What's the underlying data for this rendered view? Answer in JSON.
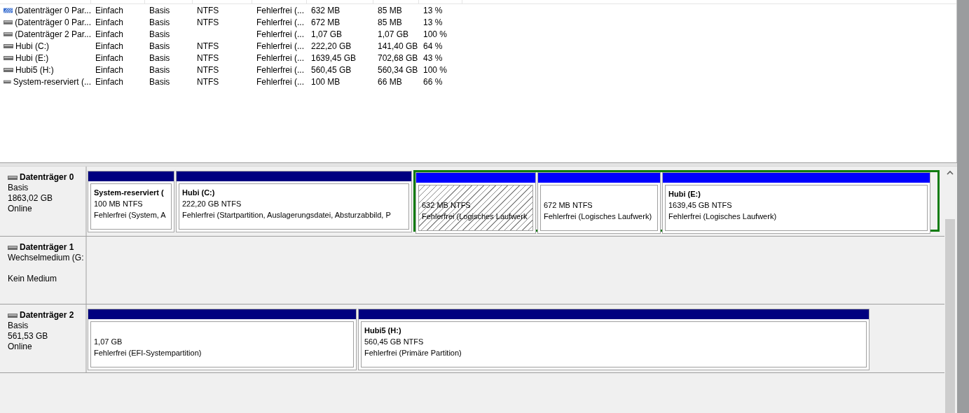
{
  "volume_list": {
    "rows": [
      {
        "selected": true,
        "cells": [
          "(Datenträger 0 Par...",
          "Einfach",
          "Basis",
          "NTFS",
          "Fehlerfrei (...",
          "632 MB",
          "85 MB",
          "13 %"
        ]
      },
      {
        "selected": false,
        "cells": [
          "(Datenträger 0 Par...",
          "Einfach",
          "Basis",
          "NTFS",
          "Fehlerfrei (...",
          "672 MB",
          "85 MB",
          "13 %"
        ]
      },
      {
        "selected": false,
        "cells": [
          "(Datenträger 2 Par...",
          "Einfach",
          "Basis",
          "",
          "Fehlerfrei (...",
          "1,07 GB",
          "1,07 GB",
          "100 %"
        ]
      },
      {
        "selected": false,
        "cells": [
          "Hubi (C:)",
          "Einfach",
          "Basis",
          "NTFS",
          "Fehlerfrei (...",
          "222,20 GB",
          "141,40 GB",
          "64 %"
        ]
      },
      {
        "selected": false,
        "cells": [
          "Hubi (E:)",
          "Einfach",
          "Basis",
          "NTFS",
          "Fehlerfrei (...",
          "1639,45 GB",
          "702,68 GB",
          "43 %"
        ]
      },
      {
        "selected": false,
        "cells": [
          "Hubi5 (H:)",
          "Einfach",
          "Basis",
          "NTFS",
          "Fehlerfrei (...",
          "560,45 GB",
          "560,34 GB",
          "100 %"
        ]
      },
      {
        "selected": false,
        "cells": [
          "System-reserviert (...",
          "Einfach",
          "Basis",
          "NTFS",
          "Fehlerfrei (...",
          "100 MB",
          "66 MB",
          "66 %"
        ]
      }
    ]
  },
  "disks": [
    {
      "title": "Datenträger 0",
      "lines": [
        "Basis",
        "1863,02 GB",
        "Online"
      ],
      "partitions": [
        {
          "kind": "primary",
          "selected": false,
          "name": "System-reserviert  (",
          "size": "100 MB NTFS",
          "status": "Fehlerfrei (System, A"
        },
        {
          "kind": "primary",
          "selected": false,
          "name": "Hubi  (C:)",
          "size": "222,20 GB NTFS",
          "status": "Fehlerfrei (Startpartition, Auslagerungsdatei, Absturzabbild, P"
        },
        {
          "kind": "extended",
          "children": [
            {
              "kind": "logical",
              "selected": true,
              "size": "632 MB NTFS",
              "status": "Fehlerfrei (Logisches Laufwerk"
            },
            {
              "kind": "logical",
              "selected": false,
              "size": "672 MB NTFS",
              "status": "Fehlerfrei (Logisches Laufwerk)"
            },
            {
              "kind": "logical",
              "selected": false,
              "name": "Hubi  (E:)",
              "size": "1639,45 GB NTFS",
              "status": "Fehlerfrei (Logisches Laufwerk)"
            }
          ]
        }
      ]
    },
    {
      "title": "Datenträger 1",
      "kind": "removable",
      "lines": [
        "Wechselmedium (G:",
        "Kein Medium"
      ]
    },
    {
      "title": "Datenträger 2",
      "lines": [
        "Basis",
        "561,53 GB",
        "Online"
      ],
      "partitions": [
        {
          "kind": "primary",
          "selected": false,
          "size": "1,07 GB",
          "status": "Fehlerfrei (EFI-Systempartition)"
        },
        {
          "kind": "primary",
          "selected": false,
          "name": "Hubi5  (H:)",
          "size": "560,45 GB NTFS",
          "status": "Fehlerfrei (Primäre Partition)"
        }
      ]
    }
  ]
}
